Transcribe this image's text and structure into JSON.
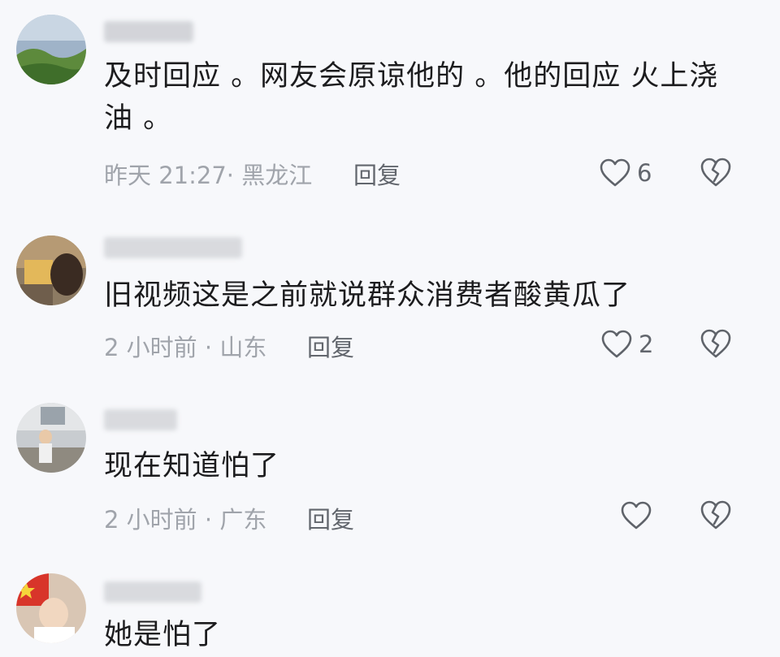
{
  "comments": [
    {
      "content": "及时回应 。网友会原谅他的 。他的回应 火上浇油 。",
      "time": "昨天 21:27",
      "separator": "·",
      "location": "黑龙江",
      "reply_label": "回复",
      "like_count": "6"
    },
    {
      "content": "旧视频这是之前就说群众消费者酸黄瓜了",
      "time": "2 小时前",
      "separator": "·",
      "location": "山东",
      "reply_label": "回复",
      "like_count": "2"
    },
    {
      "content": "现在知道怕了",
      "time": "2 小时前",
      "separator": "·",
      "location": "广东",
      "reply_label": "回复",
      "like_count": ""
    },
    {
      "content": "她是怕了"
    }
  ],
  "icons": {
    "like": "heart-outline-icon",
    "dislike": "broken-heart-icon"
  },
  "colors": {
    "background": "#f7f8fb",
    "text": "#1c1c1e",
    "meta": "#a0a4ab",
    "action": "#62666d"
  }
}
